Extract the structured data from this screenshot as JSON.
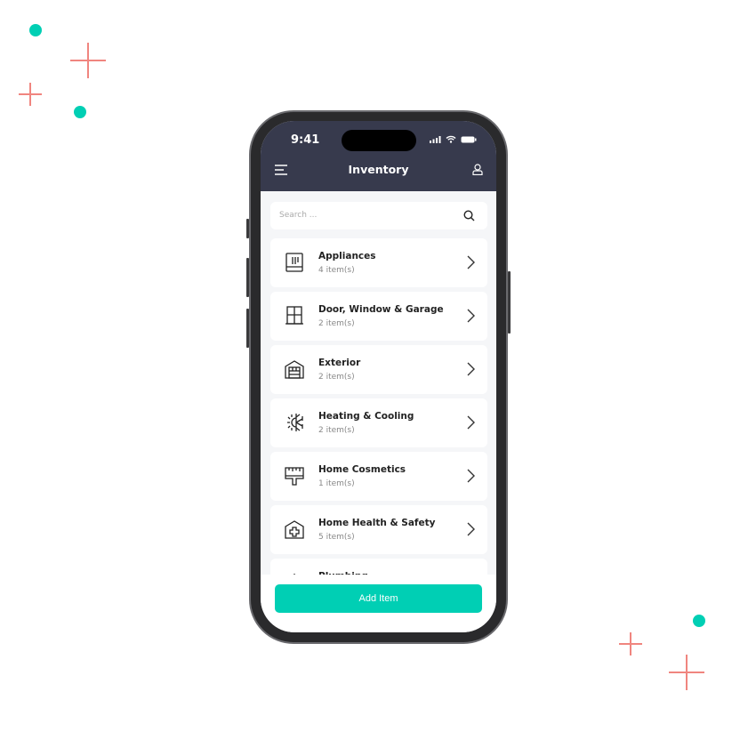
{
  "status_bar": {
    "time": "9:41"
  },
  "header": {
    "title": "Inventory",
    "menu_icon": "menu-icon",
    "user_icon": "user-icon"
  },
  "search": {
    "placeholder": "Search ..."
  },
  "categories": [
    {
      "name": "Appliances",
      "count": "4 item(s)",
      "icon": "refrigerator-icon"
    },
    {
      "name": "Door, Window & Garage",
      "count": "2 item(s)",
      "icon": "window-icon"
    },
    {
      "name": "Exterior",
      "count": "2 item(s)",
      "icon": "garage-icon"
    },
    {
      "name": "Heating & Cooling",
      "count": "2 item(s)",
      "icon": "sun-snowflake-icon"
    },
    {
      "name": "Home Cosmetics",
      "count": "1 item(s)",
      "icon": "paint-brush-icon"
    },
    {
      "name": "Home Health & Safety",
      "count": "5 item(s)",
      "icon": "house-medical-icon"
    },
    {
      "name": "Plumbing",
      "icon": "plumbing-icon"
    }
  ],
  "footer": {
    "add_label": "Add Item"
  },
  "colors": {
    "accent": "#00cfb4",
    "header": "#373a4d",
    "decor_cross": "#f0857f"
  }
}
